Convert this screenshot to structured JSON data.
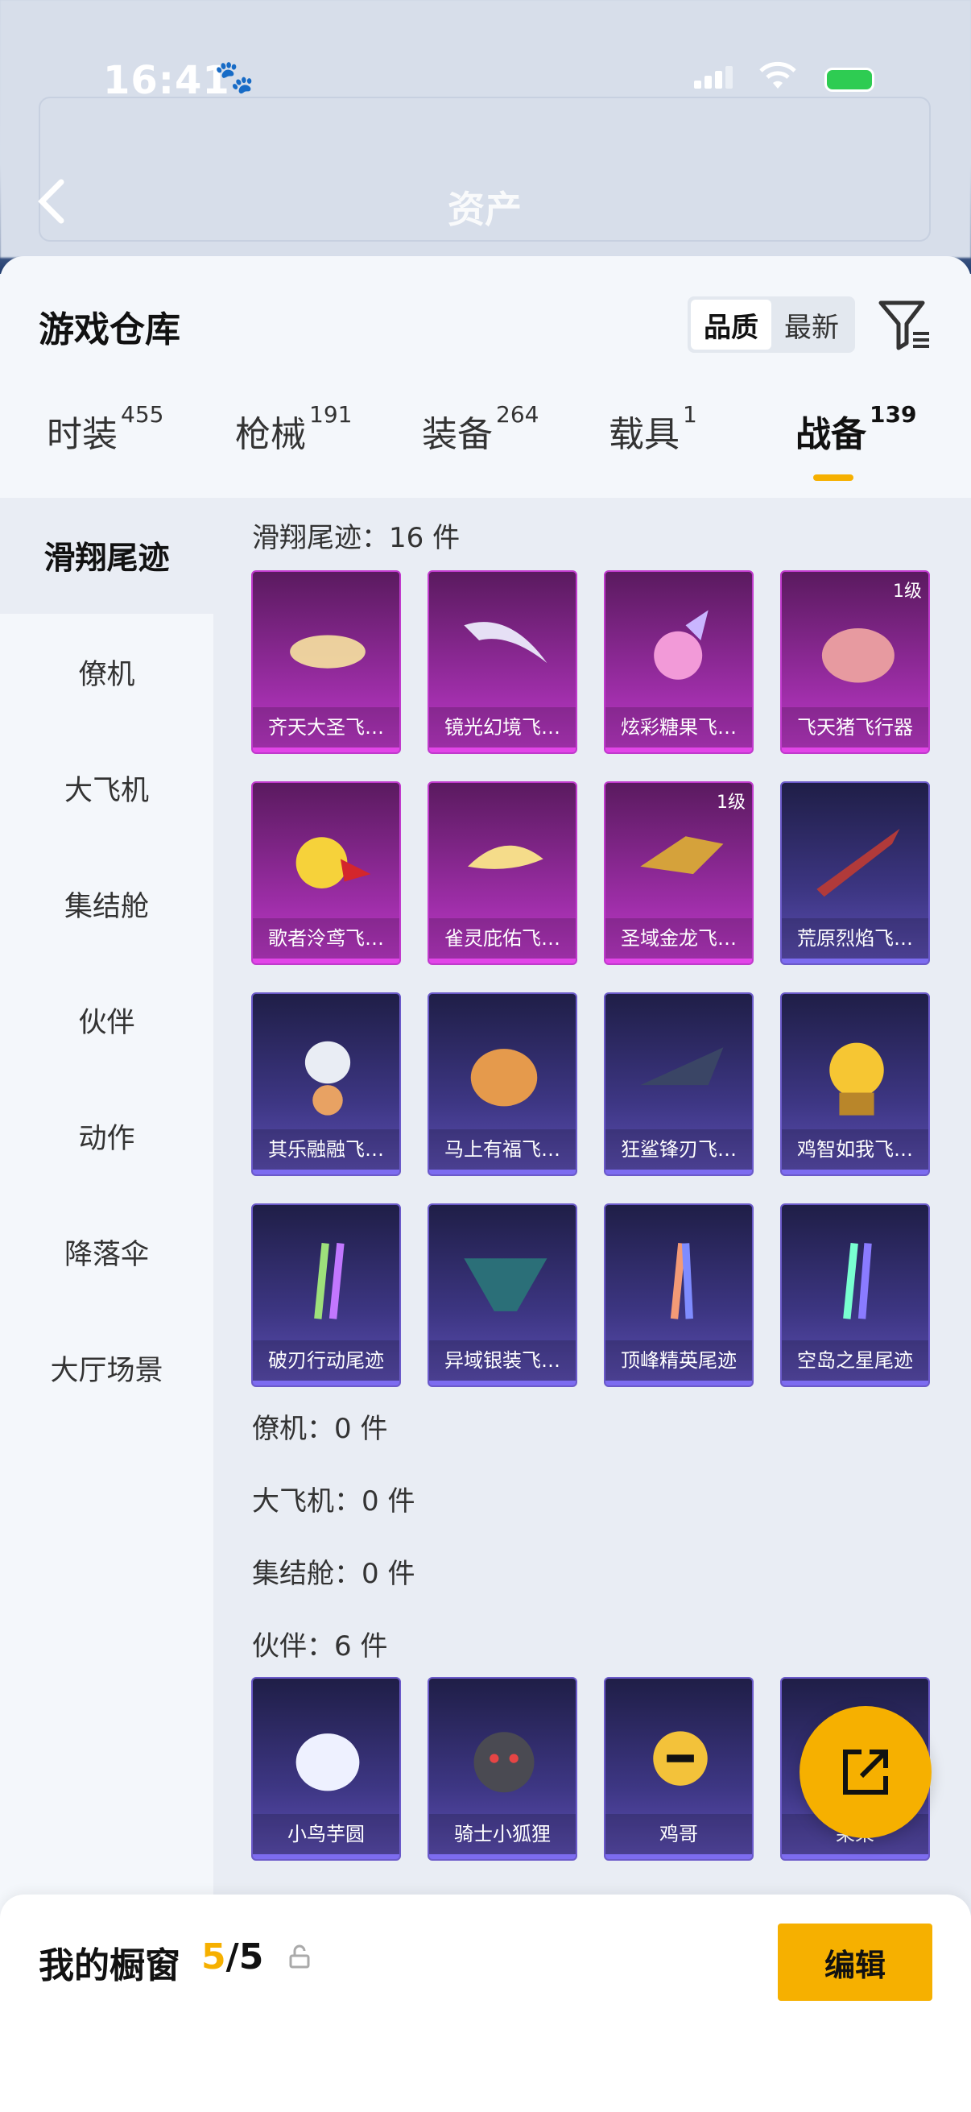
{
  "status_bar": {
    "time": "16:41",
    "paw": "🐾"
  },
  "header": {
    "title": "资产",
    "back_icon": "back-arrow-icon"
  },
  "sheet": {
    "title": "游戏仓库",
    "sort": {
      "options": [
        "品质",
        "最新"
      ],
      "selected": "品质"
    },
    "filter_icon": "filter-icon"
  },
  "tabs": [
    {
      "label": "时装",
      "count": "455"
    },
    {
      "label": "枪械",
      "count": "191"
    },
    {
      "label": "装备",
      "count": "264"
    },
    {
      "label": "载具",
      "count": "1"
    },
    {
      "label": "战备",
      "count": "139",
      "active": true
    }
  ],
  "sidebar": {
    "items": [
      {
        "label": "滑翔尾迹",
        "active": true
      },
      {
        "label": "僚机"
      },
      {
        "label": "大飞机"
      },
      {
        "label": "集结舱"
      },
      {
        "label": "伙伴"
      },
      {
        "label": "动作"
      },
      {
        "label": "降落伞"
      },
      {
        "label": "大厅场景"
      }
    ]
  },
  "sections": {
    "trails": {
      "header": "滑翔尾迹：16 件"
    },
    "wingman": {
      "header": "僚机：0 件"
    },
    "bigplane": {
      "header": "大飞机：0 件"
    },
    "capsule": {
      "header": "集结舱：0 件"
    },
    "partner": {
      "header": "伙伴：6 件"
    }
  },
  "trail_items": [
    {
      "name": "齐天大圣飞…",
      "rarity": "epic",
      "level": ""
    },
    {
      "name": "镜光幻境飞…",
      "rarity": "epic",
      "level": ""
    },
    {
      "name": "炫彩糖果飞…",
      "rarity": "epic",
      "level": ""
    },
    {
      "name": "飞天猪飞行器",
      "rarity": "epic",
      "level": "1级"
    },
    {
      "name": "歌者泠鸢飞…",
      "rarity": "epic",
      "level": ""
    },
    {
      "name": "雀灵庇佑飞…",
      "rarity": "epic",
      "level": ""
    },
    {
      "name": "圣域金龙飞…",
      "rarity": "epic",
      "level": "1级"
    },
    {
      "name": "荒原烈焰飞…",
      "rarity": "purple",
      "level": ""
    },
    {
      "name": "其乐融融飞…",
      "rarity": "purple",
      "level": ""
    },
    {
      "name": "马上有福飞…",
      "rarity": "purple",
      "level": ""
    },
    {
      "name": "狂鲨锋刃飞…",
      "rarity": "purple",
      "level": ""
    },
    {
      "name": "鸡智如我飞…",
      "rarity": "purple",
      "level": ""
    },
    {
      "name": "破刃行动尾迹",
      "rarity": "purple",
      "level": ""
    },
    {
      "name": "异域银装飞…",
      "rarity": "purple",
      "level": ""
    },
    {
      "name": "顶峰精英尾迹",
      "rarity": "purple",
      "level": ""
    },
    {
      "name": "空岛之星尾迹",
      "rarity": "purple",
      "level": ""
    }
  ],
  "partner_items": [
    {
      "name": "小鸟芋圆",
      "rarity": "purple"
    },
    {
      "name": "骑士小狐狸",
      "rarity": "purple"
    },
    {
      "name": "鸡哥",
      "rarity": "purple"
    },
    {
      "name": "呆呆",
      "rarity": "purple"
    }
  ],
  "fab": {
    "icon": "share-external-icon"
  },
  "bottom_bar": {
    "label": "我的橱窗",
    "count_current": "5",
    "count_sep": "/",
    "count_total": "5",
    "lock_icon": "unlock-icon",
    "edit_label": "编辑"
  },
  "colors": {
    "accent": "#f6b000",
    "epic": "#c03acc",
    "purple": "#6b5ac9"
  }
}
